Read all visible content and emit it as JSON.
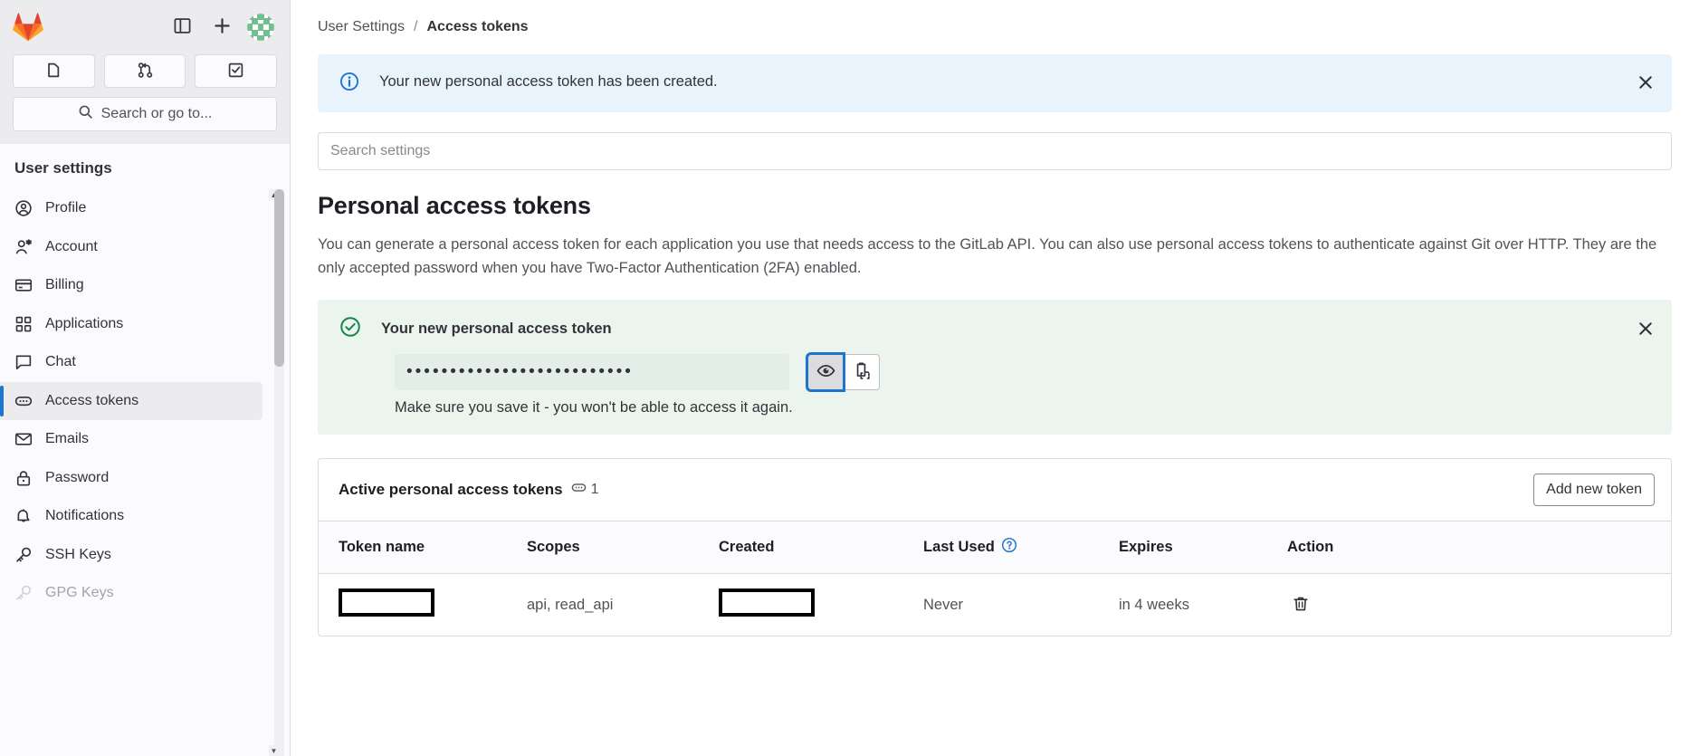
{
  "sidebar": {
    "logo_icon": "gitlab-logo",
    "toggle_icon": "sidebar-toggle-icon",
    "create_icon": "plus-icon",
    "avatar_icon": "user-avatar-identicon",
    "quick_actions": [
      {
        "name": "issues",
        "icon": "issues-icon"
      },
      {
        "name": "merge-requests",
        "icon": "merge-request-icon"
      },
      {
        "name": "todos",
        "icon": "todo-check-icon"
      }
    ],
    "search": {
      "label": "Search or go to...",
      "icon": "search-icon"
    },
    "heading": "User settings",
    "items": [
      {
        "label": "Profile",
        "icon": "profile-icon",
        "active": false,
        "muted": false
      },
      {
        "label": "Account",
        "icon": "account-icon",
        "active": false,
        "muted": false
      },
      {
        "label": "Billing",
        "icon": "billing-card-icon",
        "active": false,
        "muted": false
      },
      {
        "label": "Applications",
        "icon": "applications-icon",
        "active": false,
        "muted": false
      },
      {
        "label": "Chat",
        "icon": "chat-bubble-icon",
        "active": false,
        "muted": false
      },
      {
        "label": "Access tokens",
        "icon": "token-icon",
        "active": true,
        "muted": false
      },
      {
        "label": "Emails",
        "icon": "envelope-icon",
        "active": false,
        "muted": false
      },
      {
        "label": "Password",
        "icon": "lock-icon",
        "active": false,
        "muted": false
      },
      {
        "label": "Notifications",
        "icon": "bell-icon",
        "active": false,
        "muted": false
      },
      {
        "label": "SSH Keys",
        "icon": "key-icon",
        "active": false,
        "muted": false
      },
      {
        "label": "GPG Keys",
        "icon": "key-icon",
        "active": false,
        "muted": true
      }
    ]
  },
  "breadcrumb": {
    "parent": "User Settings",
    "separator": "/",
    "current": "Access tokens"
  },
  "alert": {
    "icon": "info-circle-icon",
    "message": "Your new personal access token has been created.",
    "close_icon": "close-icon",
    "bg_color": "#e9f3fc",
    "accent_color": "#1f75cb"
  },
  "settings_search": {
    "placeholder": "Search settings",
    "value": ""
  },
  "page": {
    "title": "Personal access tokens",
    "description": "You can generate a personal access token for each application you use that needs access to the GitLab API. You can also use personal access tokens to authenticate against Git over HTTP. They are the only accepted password when you have Two-Factor Authentication (2FA) enabled."
  },
  "token_panel": {
    "icon": "check-circle-icon",
    "title": "Your new personal access token",
    "masked_value": "••••••••••••••••••••••••••",
    "reveal_icon": "eye-icon",
    "copy_icon": "clipboard-copy-icon",
    "note": "Make sure you save it - you won't be able to access it again.",
    "close_icon": "close-icon",
    "bg_color": "#ecf4ee",
    "accent_color": "#108548"
  },
  "tokens_card": {
    "title": "Active personal access tokens",
    "count_icon": "token-icon",
    "count": "1",
    "add_button": "Add new token",
    "columns": [
      {
        "label": "Token name",
        "help": false
      },
      {
        "label": "Scopes",
        "help": false
      },
      {
        "label": "Created",
        "help": false
      },
      {
        "label": "Last Used",
        "help": true,
        "help_icon": "question-circle-icon"
      },
      {
        "label": "Expires",
        "help": false
      },
      {
        "label": "Action",
        "help": false
      }
    ],
    "rows": [
      {
        "token_name": "",
        "token_name_redacted": true,
        "scopes": "api, read_api",
        "created": "",
        "created_redacted": true,
        "last_used": "Never",
        "expires": "in 4 weeks",
        "action_icon": "trash-icon"
      }
    ]
  }
}
